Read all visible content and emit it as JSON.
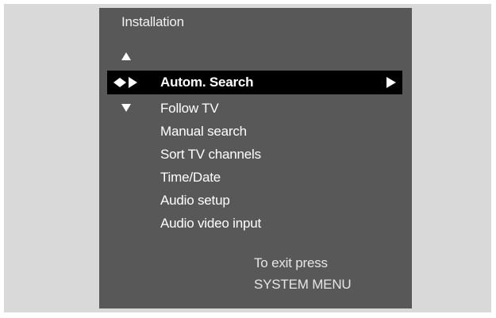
{
  "screen": {
    "title": "Installation"
  },
  "menu": {
    "selected": {
      "label": "Autom. Search"
    },
    "items": [
      {
        "label": "Follow TV"
      },
      {
        "label": "Manual search"
      },
      {
        "label": "Sort TV channels"
      },
      {
        "label": "Time/Date"
      },
      {
        "label": "Audio setup"
      },
      {
        "label": "Audio video input"
      }
    ]
  },
  "footer": {
    "exit_line1": "To exit press",
    "exit_line2": "SYSTEM MENU"
  },
  "icons": {
    "nav_up": "triangle-up-icon",
    "nav_down": "triangle-down-icon",
    "selection": "left-right-play-icon",
    "submenu": "play-right-icon"
  },
  "colors": {
    "page_background": "#d9d9d9",
    "menu_background": "#585858",
    "selected_background": "#000000",
    "text": "#ffffff"
  }
}
